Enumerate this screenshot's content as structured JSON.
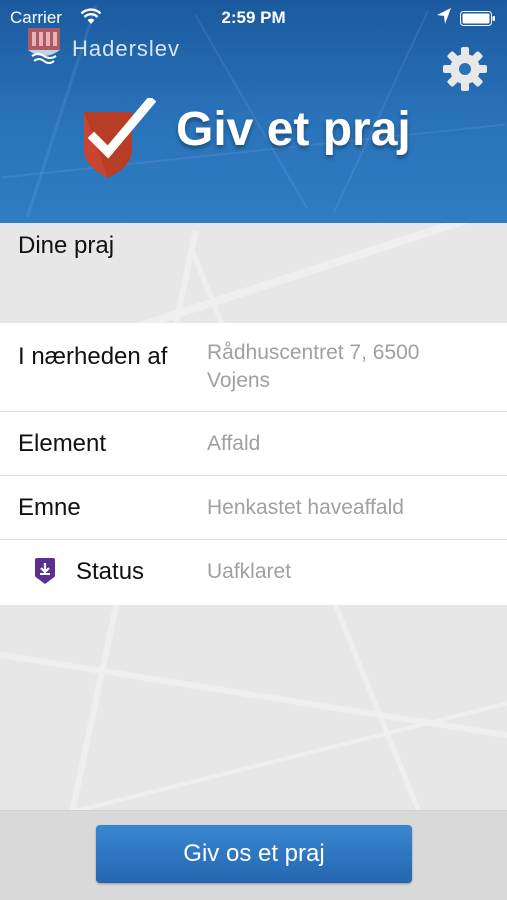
{
  "status_bar": {
    "carrier": "Carrier",
    "time": "2:59 PM",
    "wifi_icon": "wifi-icon",
    "location_icon": "location-arrow-icon",
    "battery_icon": "battery-icon"
  },
  "header": {
    "brand_name": "Haderslev",
    "brand_logo_icon": "haderslev-crest-icon",
    "app_title": "Giv et praj",
    "app_icon": "checkmark-shield-icon",
    "settings_icon": "gear-icon"
  },
  "section": {
    "title": "Dine praj"
  },
  "details": {
    "near_label": "I nærheden af",
    "near_value": "Rådhuscentret 7, 6500 Vojens",
    "element_label": "Element",
    "element_value": "Affald",
    "topic_label": "Emne",
    "topic_value": "Henkastet haveaffald",
    "status_label": "Status",
    "status_value": "Uafklaret",
    "status_icon": "status-pin-icon"
  },
  "footer": {
    "cta_label": "Giv os et praj"
  },
  "colors": {
    "header_blue": "#2a73bb",
    "cta_blue": "#2f76c0",
    "accent_red": "#c9452f",
    "status_purple": "#5b2f8f"
  }
}
